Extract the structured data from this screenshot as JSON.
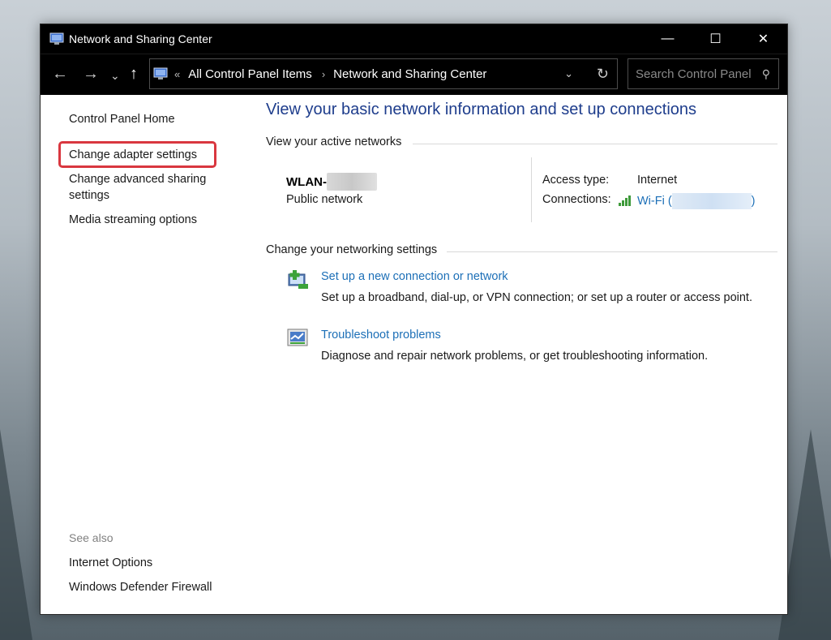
{
  "window": {
    "title": "Network and Sharing Center"
  },
  "titlebar_buttons": {
    "minimize": "—",
    "maximize": "☐",
    "close": "✕"
  },
  "nav": {
    "back": "←",
    "forward": "→",
    "recent": "⌄",
    "up": "↑",
    "address": {
      "prefix": "«",
      "crumbs": [
        "All Control Panel Items",
        "Network and Sharing Center"
      ],
      "separator": "›"
    },
    "search_placeholder": "Search Control Panel"
  },
  "sidebar": {
    "items": [
      {
        "label": "Control Panel Home"
      },
      {
        "label": "Change adapter settings"
      },
      {
        "label": "Change advanced sharing settings"
      },
      {
        "label": "Media streaming options"
      }
    ],
    "see_also_label": "See also",
    "see_also": [
      {
        "label": "Internet Options"
      },
      {
        "label": "Windows Defender Firewall"
      }
    ]
  },
  "main": {
    "heading": "View your basic network information and set up connections",
    "active_networks_title": "View your active networks",
    "network": {
      "name_prefix": "WLAN-",
      "type": "Public network",
      "access_type_label": "Access type:",
      "access_type_value": "Internet",
      "connections_label": "Connections:",
      "connection_link_prefix": "Wi-Fi (",
      "connection_link_suffix": ")"
    },
    "change_settings_title": "Change your networking settings",
    "tasks": [
      {
        "icon": "new-connection-icon",
        "link": "Set up a new connection or network",
        "desc": "Set up a broadband, dial-up, or VPN connection; or set up a router or access point."
      },
      {
        "icon": "troubleshoot-icon",
        "link": "Troubleshoot problems",
        "desc": "Diagnose and repair network problems, or get troubleshooting information."
      }
    ]
  },
  "colors": {
    "link": "#1c6fb7",
    "heading": "#1e3d8c",
    "highlight": "#d9373f"
  }
}
